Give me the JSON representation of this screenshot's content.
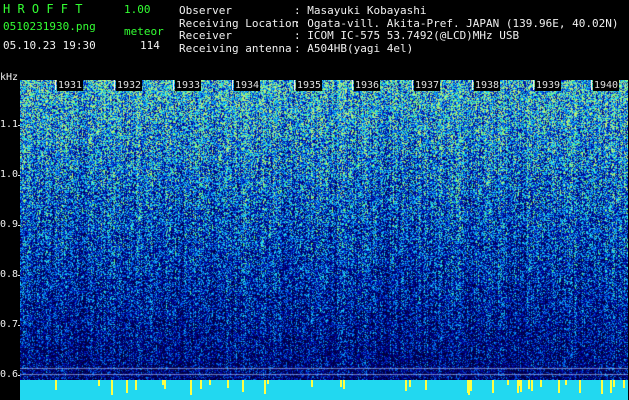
{
  "header": {
    "app_name": "H R O F F T",
    "version": "1.00",
    "filename": "0510231930.png",
    "mode_label": "meteor",
    "datetime": "05.10.23 19:30",
    "count": "114"
  },
  "info": {
    "observer_label": "Observer",
    "observer_value": ": Masayuki Kobayashi",
    "location_label": "Receiving Location",
    "location_value": ": Ogata-vill. Akita-Pref. JAPAN (139.96E, 40.02N)",
    "receiver_label": "Receiver",
    "receiver_value": ": ICOM IC-575 53.7492(@LCD)MHz USB",
    "antenna_label": "Receiving antenna",
    "antenna_value": ": A504HB(yagi 4el)"
  },
  "axis": {
    "unit": "kHz",
    "y_ticks": [
      "1.1",
      "1.0",
      "0.9",
      "0.8",
      "0.7",
      "0.6"
    ],
    "minute_labels": [
      "1931",
      "1932",
      "1933",
      "1934",
      "1935",
      "1936",
      "1937",
      "1938",
      "1939",
      "1940"
    ]
  },
  "colors": {
    "background": "#000000",
    "title_green": "#33ff33",
    "text_white": "#f0f0f0",
    "spectrum_low": "#001060",
    "spectrum_high": "#00e0ff",
    "bottom_band": "#22d8f0",
    "marker_yellow": "#ffff44"
  }
}
